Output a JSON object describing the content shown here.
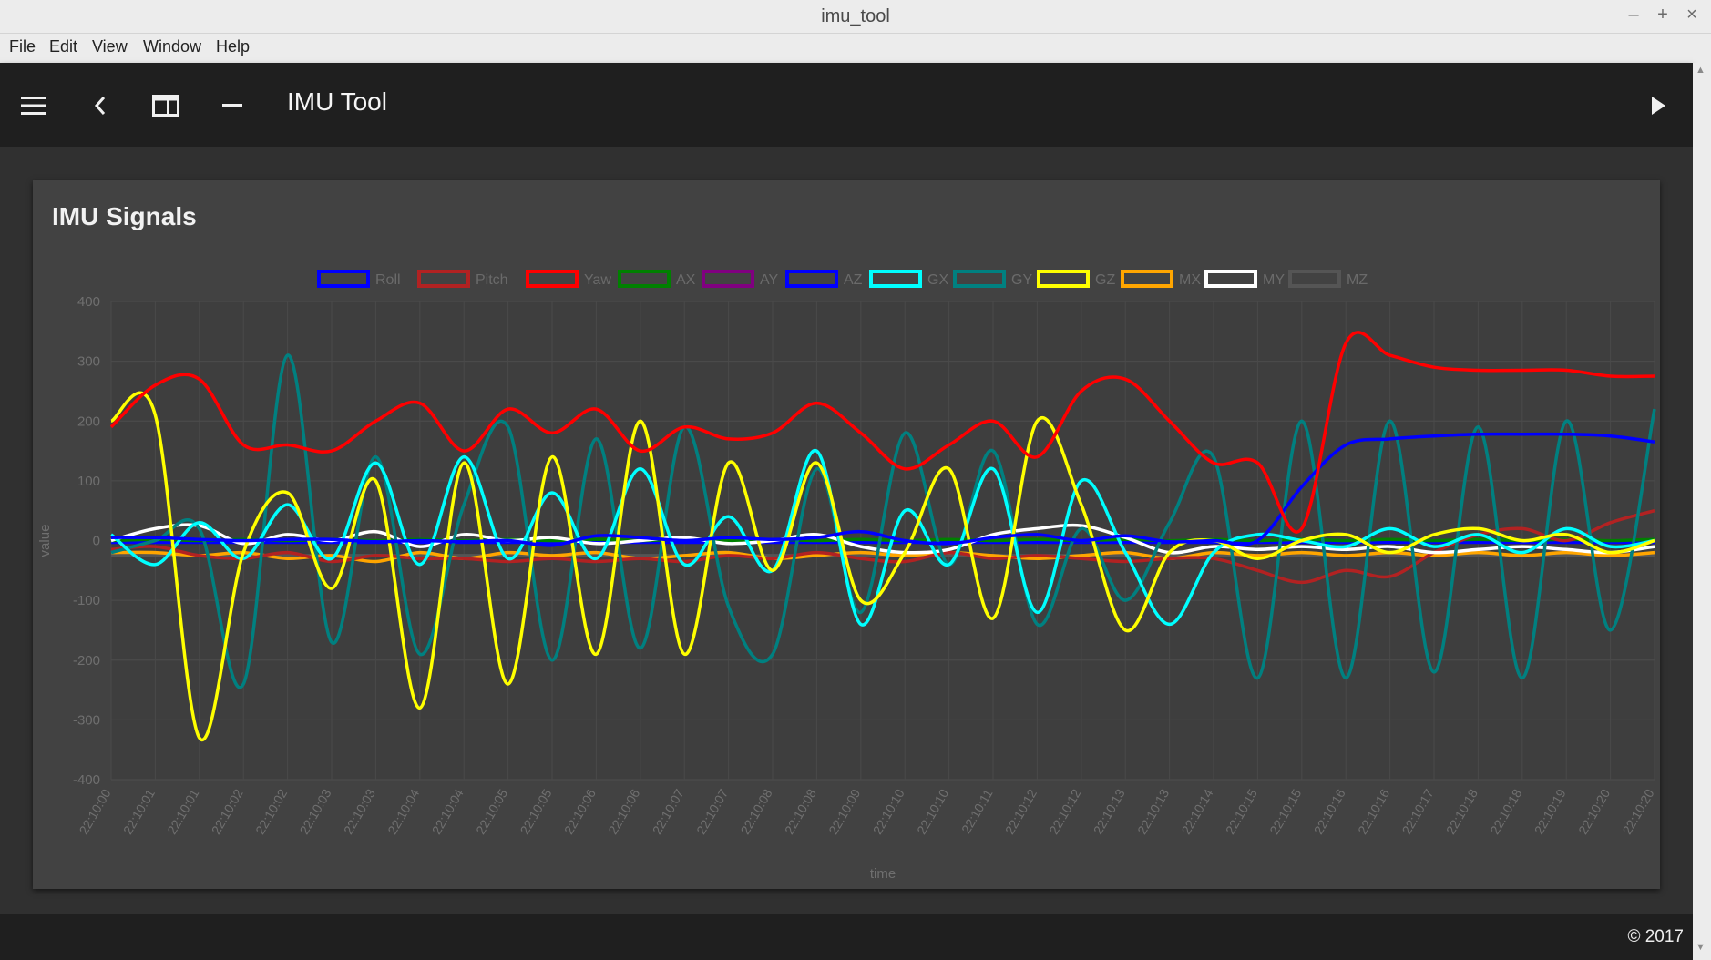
{
  "window": {
    "title": "imu_tool",
    "minimize": "–",
    "maximize": "+",
    "close": "×"
  },
  "menu": [
    "File",
    "Edit",
    "View",
    "Window",
    "Help"
  ],
  "toolbar": {
    "title": "IMU Tool",
    "icons": [
      "menu-icon",
      "back-chevron-icon",
      "layout-icon",
      "minus-icon",
      "play-icon"
    ]
  },
  "card": {
    "title": "IMU Signals"
  },
  "footer": {
    "copyright": "© 2017"
  },
  "chart_data": {
    "type": "line",
    "xlabel": "time",
    "ylabel": "value",
    "ylim": [
      -400,
      400
    ],
    "yticks": [
      400,
      300,
      200,
      100,
      0,
      -100,
      -200,
      -300,
      -400
    ],
    "categories": [
      "22:10:00",
      "22:10:01",
      "22:10:01",
      "22:10:02",
      "22:10:02",
      "22:10:03",
      "22:10:03",
      "22:10:04",
      "22:10:04",
      "22:10:05",
      "22:10:05",
      "22:10:06",
      "22:10:06",
      "22:10:07",
      "22:10:07",
      "22:10:08",
      "22:10:08",
      "22:10:09",
      "22:10:10",
      "22:10:10",
      "22:10:11",
      "22:10:12",
      "22:10:12",
      "22:10:13",
      "22:10:13",
      "22:10:14",
      "22:10:15",
      "22:10:15",
      "22:10:16",
      "22:10:16",
      "22:10:17",
      "22:10:18",
      "22:10:18",
      "22:10:19",
      "22:10:20",
      "22:10:20"
    ],
    "legend_position": "top",
    "grid": true,
    "series": [
      {
        "name": "Roll",
        "color": "#0000ff",
        "values": [
          5,
          5,
          2,
          0,
          2,
          2,
          -2,
          0,
          -2,
          0,
          -8,
          8,
          5,
          0,
          5,
          2,
          5,
          15,
          0,
          -5,
          5,
          10,
          0,
          8,
          -2,
          0,
          0,
          90,
          160,
          170,
          175,
          178,
          178,
          178,
          175,
          165
        ]
      },
      {
        "name": "Pitch",
        "color": "#b22222",
        "values": [
          -15,
          -10,
          -25,
          -30,
          -20,
          -35,
          -25,
          -30,
          -30,
          -35,
          -30,
          -35,
          -30,
          -35,
          -25,
          -30,
          -20,
          -30,
          -35,
          -20,
          -30,
          -25,
          -30,
          -35,
          -30,
          -30,
          -50,
          -70,
          -50,
          -60,
          -20,
          10,
          20,
          0,
          30,
          50
        ]
      },
      {
        "name": "Yaw",
        "color": "#ff0000",
        "values": [
          190,
          260,
          270,
          160,
          160,
          150,
          200,
          230,
          150,
          220,
          180,
          220,
          150,
          190,
          170,
          180,
          230,
          180,
          120,
          160,
          200,
          140,
          250,
          270,
          200,
          130,
          130,
          20,
          330,
          310,
          290,
          285,
          285,
          285,
          275,
          275
        ]
      },
      {
        "name": "AX",
        "color": "#008000",
        "values": [
          0,
          2,
          0,
          2,
          0,
          2,
          0,
          2,
          0,
          2,
          0,
          2,
          0,
          2,
          0,
          2,
          0,
          2,
          0,
          2,
          0,
          2,
          0,
          2,
          0,
          2,
          0,
          2,
          0,
          2,
          0,
          2,
          0,
          2,
          0,
          2
        ]
      },
      {
        "name": "AY",
        "color": "#800080",
        "values": [
          0,
          0,
          0,
          0,
          0,
          0,
          0,
          0,
          0,
          0,
          0,
          0,
          0,
          0,
          0,
          0,
          0,
          0,
          0,
          0,
          0,
          0,
          0,
          0,
          0,
          0,
          0,
          0,
          0,
          0,
          0,
          0,
          0,
          0,
          0,
          0
        ]
      },
      {
        "name": "AZ",
        "color": "#0000ff",
        "values": [
          -3,
          -3,
          -3,
          -3,
          -3,
          -3,
          -3,
          -3,
          -3,
          -3,
          -3,
          -3,
          -3,
          -3,
          -3,
          -3,
          -3,
          -3,
          -3,
          -3,
          -3,
          -3,
          -3,
          -3,
          -3,
          -3,
          -3,
          -3,
          -3,
          -3,
          -3,
          -3,
          -3,
          -3,
          -3,
          -3
        ]
      },
      {
        "name": "GX",
        "color": "#00ffff",
        "values": [
          10,
          -40,
          30,
          -30,
          60,
          -30,
          130,
          -40,
          140,
          -30,
          80,
          -30,
          120,
          -40,
          40,
          -50,
          150,
          -140,
          50,
          -40,
          120,
          -120,
          100,
          -20,
          -140,
          -20,
          10,
          0,
          -10,
          20,
          -10,
          10,
          -20,
          20,
          -10,
          0
        ]
      },
      {
        "name": "GY",
        "color": "#008080",
        "values": [
          -20,
          0,
          20,
          -240,
          310,
          -170,
          140,
          -190,
          60,
          190,
          -200,
          170,
          -180,
          190,
          -110,
          -190,
          120,
          -120,
          180,
          -40,
          150,
          -140,
          20,
          -100,
          30,
          140,
          -230,
          200,
          -230,
          200,
          -220,
          190,
          -230,
          200,
          -150,
          220
        ]
      },
      {
        "name": "GZ",
        "color": "#ffff00",
        "values": [
          200,
          210,
          -330,
          -20,
          80,
          -80,
          100,
          -280,
          130,
          -240,
          140,
          -190,
          200,
          -190,
          130,
          -50,
          130,
          -100,
          -20,
          120,
          -130,
          200,
          60,
          -150,
          -20,
          0,
          -30,
          0,
          10,
          -20,
          10,
          20,
          0,
          10,
          -20,
          0
        ]
      },
      {
        "name": "MX",
        "color": "#ffa500",
        "values": [
          -20,
          -20,
          -25,
          -20,
          -30,
          -25,
          -35,
          -20,
          -30,
          -20,
          -25,
          -20,
          -30,
          -25,
          -20,
          -30,
          -25,
          -20,
          -25,
          -20,
          -25,
          -30,
          -25,
          -20,
          -30,
          -20,
          -25,
          -20,
          -25,
          -20,
          -25,
          -20,
          -25,
          -20,
          -25,
          -20
        ]
      },
      {
        "name": "MY",
        "color": "#ffffff",
        "values": [
          0,
          20,
          25,
          -5,
          10,
          0,
          15,
          -10,
          10,
          0,
          5,
          -5,
          0,
          5,
          -5,
          0,
          10,
          -10,
          -20,
          -15,
          10,
          20,
          25,
          5,
          -20,
          -10,
          -15,
          -10,
          -15,
          -10,
          -20,
          -15,
          -10,
          -15,
          -20,
          -10
        ]
      },
      {
        "name": "MZ",
        "color": "#555555",
        "values": [
          -25,
          -25,
          -25,
          -25,
          -25,
          -25,
          -25,
          -25,
          -25,
          -25,
          -25,
          -25,
          -25,
          -25,
          -25,
          -25,
          -25,
          -25,
          -25,
          -25,
          -25,
          -25,
          -25,
          -25,
          -25,
          -25,
          -25,
          -25,
          -25,
          -25,
          -25,
          -25,
          -25,
          -25,
          -25,
          -25
        ]
      }
    ]
  }
}
